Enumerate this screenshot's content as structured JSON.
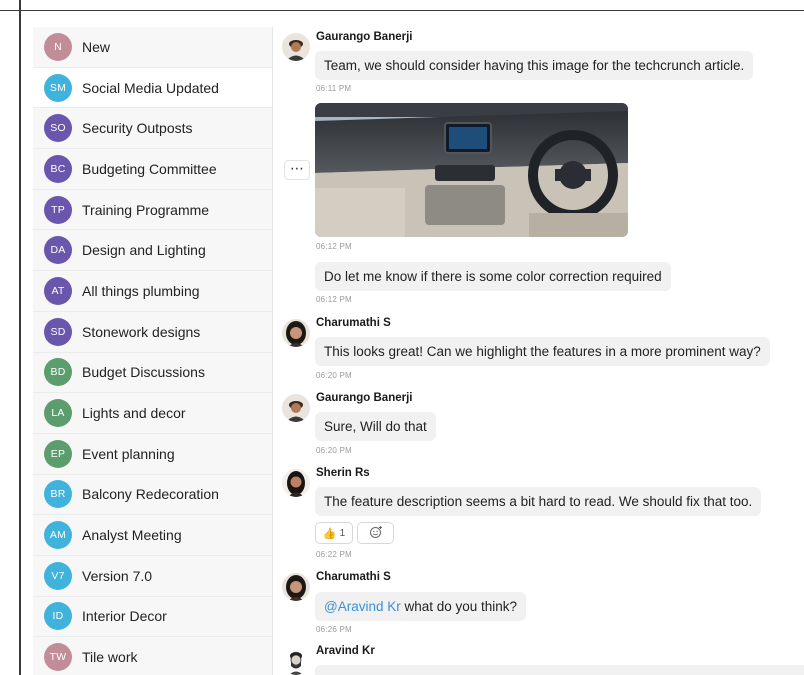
{
  "sidebar": {
    "items": [
      {
        "initials": "N",
        "label": "New",
        "color": "#c08d98"
      },
      {
        "initials": "SM",
        "label": "Social Media Updated",
        "color": "#3fb3dc"
      },
      {
        "initials": "SO",
        "label": "Security Outposts",
        "color": "#6a56ad"
      },
      {
        "initials": "BC",
        "label": "Budgeting Committee",
        "color": "#6a56ad"
      },
      {
        "initials": "TP",
        "label": "Training Programme",
        "color": "#6a56ad"
      },
      {
        "initials": "DA",
        "label": "Design and Lighting",
        "color": "#6a56ad"
      },
      {
        "initials": "AT",
        "label": "All things plumbing",
        "color": "#6a56ad"
      },
      {
        "initials": "SD",
        "label": "Stonework designs",
        "color": "#6a56ad"
      },
      {
        "initials": "BD",
        "label": "Budget Discussions",
        "color": "#5b9d6d"
      },
      {
        "initials": "LA",
        "label": "Lights and decor",
        "color": "#5b9d6d"
      },
      {
        "initials": "EP",
        "label": "Event planning",
        "color": "#5b9d6d"
      },
      {
        "initials": "BR",
        "label": "Balcony Redecoration",
        "color": "#3fb3dc"
      },
      {
        "initials": "AM",
        "label": "Analyst Meeting",
        "color": "#3fb3dc"
      },
      {
        "initials": "V7",
        "label": "Version 7.0",
        "color": "#3fb3dc"
      },
      {
        "initials": "ID",
        "label": "Interior Decor",
        "color": "#3fb3dc"
      },
      {
        "initials": "TW",
        "label": "Tile work",
        "color": "#c08d98"
      }
    ]
  },
  "chat": {
    "messages": [
      {
        "sender": "Gaurango Banerji",
        "text": "Team, we should consider having this image for the techcrunch article.",
        "time": "06:11 PM"
      },
      {
        "image_time": "06:12 PM",
        "text": "Do let me know if there is some color correction required",
        "time": "06:12 PM"
      },
      {
        "sender": "Charumathi S",
        "text": "This looks great! Can we highlight the features in a more prominent way?",
        "time": "06:20 PM"
      },
      {
        "sender": "Gaurango Banerji",
        "text": "Sure, Will do that",
        "time": "06:20 PM"
      },
      {
        "sender": "Sherin Rs",
        "text": "The feature description seems a bit hard to read. We should fix that too.",
        "time": "06:22 PM",
        "reaction_emoji": "👍",
        "reaction_count": "1"
      },
      {
        "sender": "Charumathi S",
        "mention": "@Aravind Kr",
        "text": " what do you think?",
        "time": "06:26 PM"
      },
      {
        "sender": "Aravind Kr"
      }
    ],
    "more_icon": "⋯",
    "add_reaction_icon": "add-emoji-icon"
  }
}
